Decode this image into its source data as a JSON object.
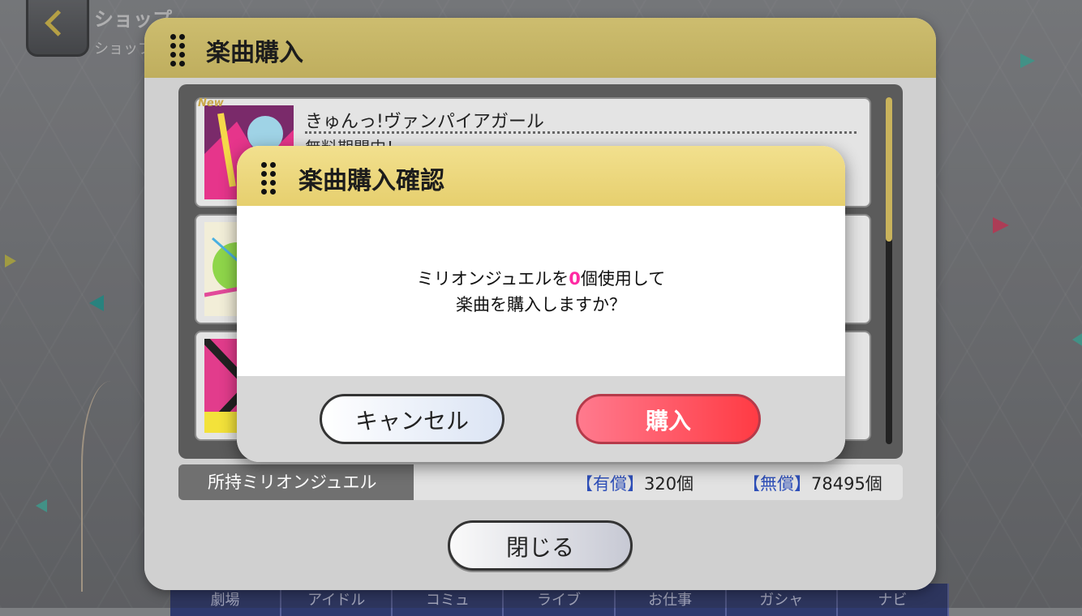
{
  "header": {
    "title": "ショップ",
    "subtitle": "ショップ"
  },
  "bottom_nav": {
    "items": [
      "劇場",
      "アイドル",
      "コミュ",
      "ライブ",
      "お仕事",
      "ガシャ",
      "ナビ"
    ]
  },
  "main_dialog": {
    "title": "楽曲購入",
    "songs": [
      {
        "badge": "New",
        "name": "きゅんっ!ヴァンパイアガール",
        "status": "無料期間中！"
      }
    ],
    "jewels": {
      "label": "所持ミリオンジュエル",
      "paid_tag": "【有償】",
      "paid_value": "320個",
      "free_tag": "【無償】",
      "free_value": "78495個"
    },
    "close_label": "閉じる"
  },
  "confirm_dialog": {
    "title": "楽曲購入確認",
    "message_pre": "ミリオンジュエルを",
    "message_count": "0",
    "message_post": "個使用して",
    "message_line2": "楽曲を購入しますか？",
    "cancel_label": "キャンセル",
    "buy_label": "購入"
  },
  "colors": {
    "header_gold": "#cdbd6f",
    "confirm_gold": "#f2e08e",
    "buy_pink": "#ff3b44",
    "count_pink": "#ff2aa3",
    "jewel_tag_blue": "#2e4fb8"
  }
}
